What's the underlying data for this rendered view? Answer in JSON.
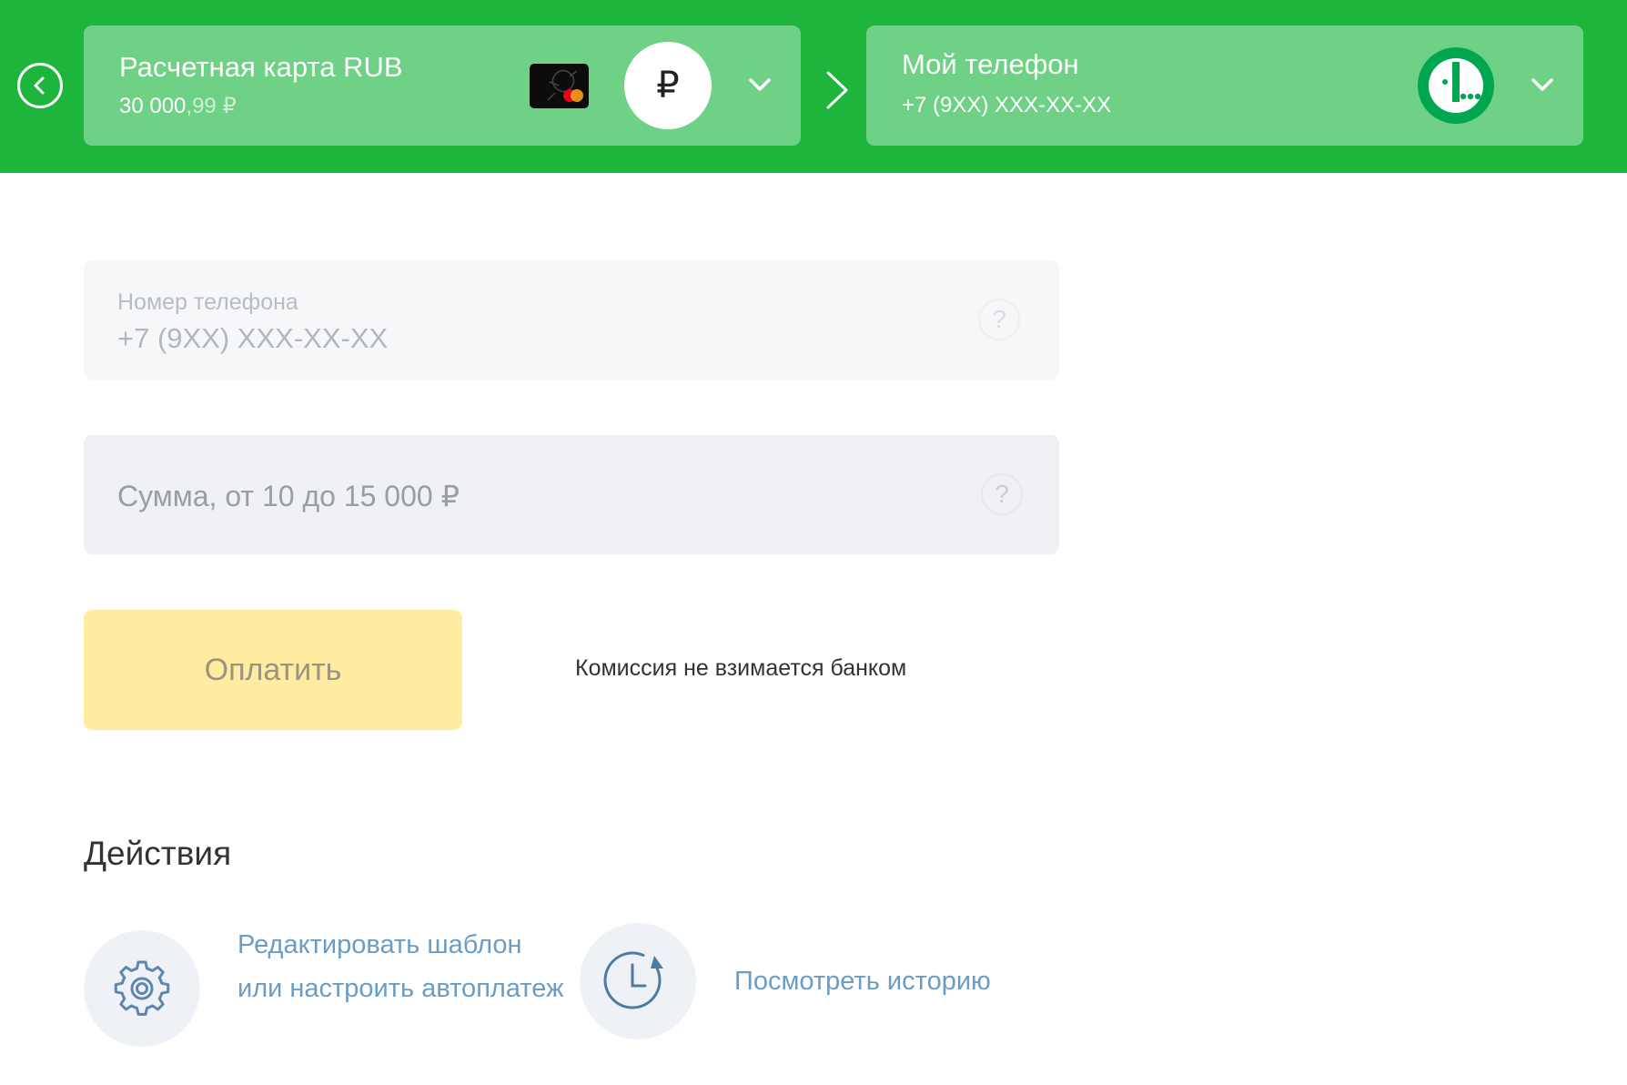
{
  "header": {
    "source_card": {
      "title": "Расчетная карта RUB",
      "balance_main": "30 000",
      "balance_cents": ",99 ₽",
      "currency_symbol": "₽"
    },
    "destination": {
      "title": "Мой телефон",
      "phone": "+7 (9XX) XXX-XX-XX"
    }
  },
  "form": {
    "phone_field": {
      "label": "Номер телефона",
      "value": "+7 (9XX) XXX-XX-XX"
    },
    "amount_field": {
      "placeholder": "Сумма, от 10 до 15 000 ₽"
    },
    "help_symbol": "?",
    "pay_button": "Оплатить",
    "commission_note": "Комиссия не взимается банком"
  },
  "actions": {
    "title": "Действия",
    "items": [
      {
        "label": "Редактировать шаблон или настроить автоплатеж",
        "icon": "gear-icon"
      },
      {
        "label": "Посмотреть историю",
        "icon": "history-icon"
      }
    ]
  },
  "colors": {
    "header_green": "#1db53b",
    "card_green": "#6fd185",
    "pay_button_yellow": "#ffeca0",
    "link_blue": "#6b9dc4",
    "operator_green": "#00a650"
  }
}
